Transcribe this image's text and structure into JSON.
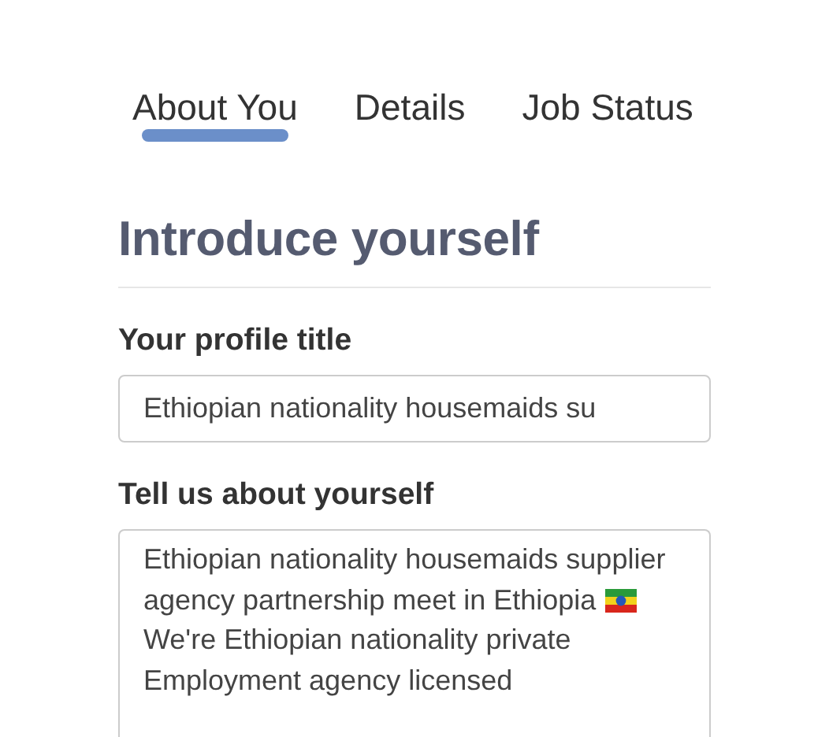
{
  "tabs": [
    {
      "label": "About You",
      "selected": true
    },
    {
      "label": "Details",
      "selected": false
    },
    {
      "label": "Job Status",
      "selected": false
    }
  ],
  "heading": "Introduce yourself",
  "profile_title": {
    "label": "Your profile title",
    "value": "Ethiopian nationality housemaids su"
  },
  "about": {
    "label": "Tell us about yourself",
    "lines": [
      "Ethiopian nationality housemaids supplier",
      "agency partnership meet in Ethiopia",
      "We're Ethiopian nationality private",
      "Employment agency licensed"
    ]
  }
}
